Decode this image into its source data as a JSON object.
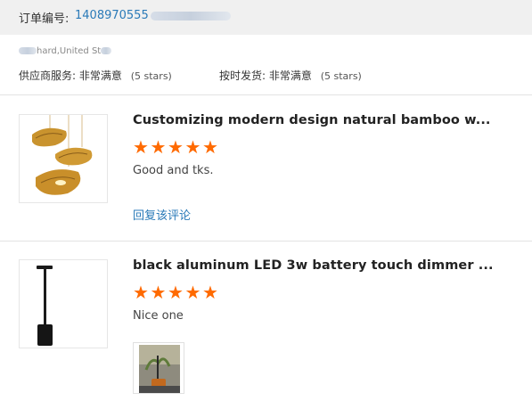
{
  "order": {
    "label": "订单编号:",
    "number": "1408970555"
  },
  "address": {
    "text": "hard,United St"
  },
  "ratings": {
    "supplier_label": "供应商服务:",
    "supplier_value": "非常满意",
    "supplier_note": "(5 stars)",
    "shipping_label": "按时发货:",
    "shipping_value": "非常满意",
    "shipping_note": "(5 stars)"
  },
  "reviews": [
    {
      "title": "Customizing modern design natural bamboo w...",
      "stars": 5,
      "comment": "Good and tks.",
      "reply_label": "回复该评论"
    },
    {
      "title": "black aluminum LED 3w battery touch dimmer ...",
      "stars": 5,
      "comment": "Nice one"
    }
  ],
  "colors": {
    "accent": "#2a7ab8",
    "star": "#ff6a00",
    "bar": "#f0f0f0"
  },
  "icons": {
    "star": "star-icon"
  }
}
